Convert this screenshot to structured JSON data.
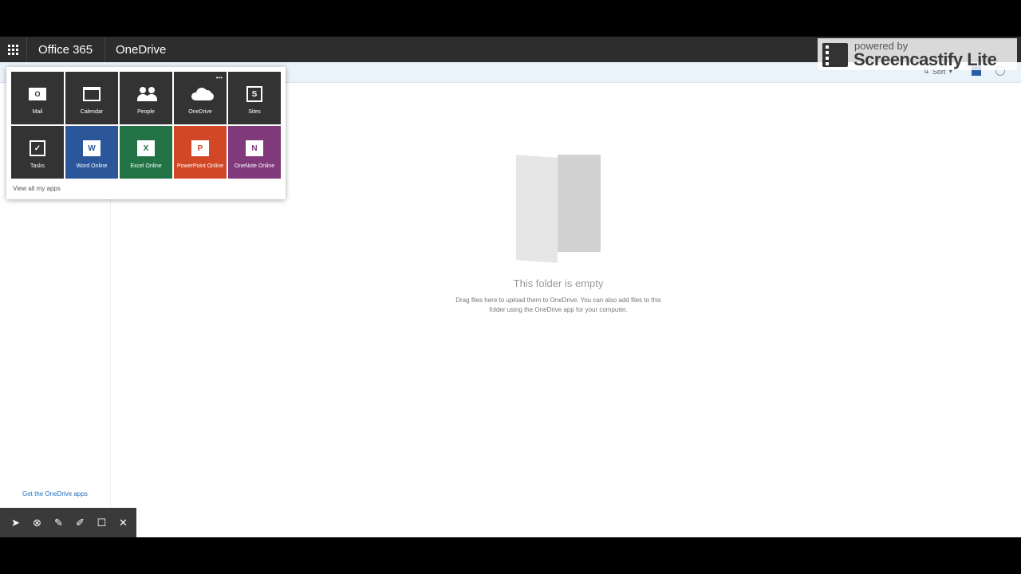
{
  "suitebar": {
    "brand": "Office 365",
    "app": "OneDrive"
  },
  "cmdbar": {
    "sort_label": "Sort"
  },
  "launcher": {
    "tiles": [
      {
        "label": "Mail",
        "color": "#333333",
        "icon": "mail-icon",
        "glyph": "O"
      },
      {
        "label": "Calendar",
        "color": "#333333",
        "icon": "calendar-icon"
      },
      {
        "label": "People",
        "color": "#333333",
        "icon": "people-icon"
      },
      {
        "label": "OneDrive",
        "color": "#333333",
        "icon": "cloud-icon",
        "more": "•••"
      },
      {
        "label": "Sites",
        "color": "#333333",
        "icon": "sites-icon",
        "glyph": "S"
      },
      {
        "label": "Tasks",
        "color": "#333333",
        "icon": "checkbox-icon",
        "glyph": "✓"
      },
      {
        "label": "Word Online",
        "color": "#2b579a",
        "icon": "word-icon",
        "glyph": "W"
      },
      {
        "label": "Excel Online",
        "color": "#217346",
        "icon": "excel-icon",
        "glyph": "X"
      },
      {
        "label": "PowerPoint Online",
        "color": "#d24726",
        "icon": "powerpoint-icon",
        "glyph": "P"
      },
      {
        "label": "OneNote Online",
        "color": "#80397b",
        "icon": "onenote-icon",
        "glyph": "N"
      }
    ],
    "view_all": "View all my apps"
  },
  "leftnav": {
    "get_apps": "Get the OneDrive apps"
  },
  "main": {
    "empty_title": "This folder is empty",
    "empty_desc": "Drag files here to upload them to OneDrive. You can also add files to this folder using the OneDrive app for your computer."
  },
  "watermark": {
    "powered": "powered by",
    "name": "Screencastify Lite"
  },
  "annotation_toolbar": {
    "tools": [
      "cursor-icon",
      "circle-x-icon",
      "pen-icon",
      "highlighter-icon",
      "rectangle-icon",
      "close-icon"
    ]
  }
}
